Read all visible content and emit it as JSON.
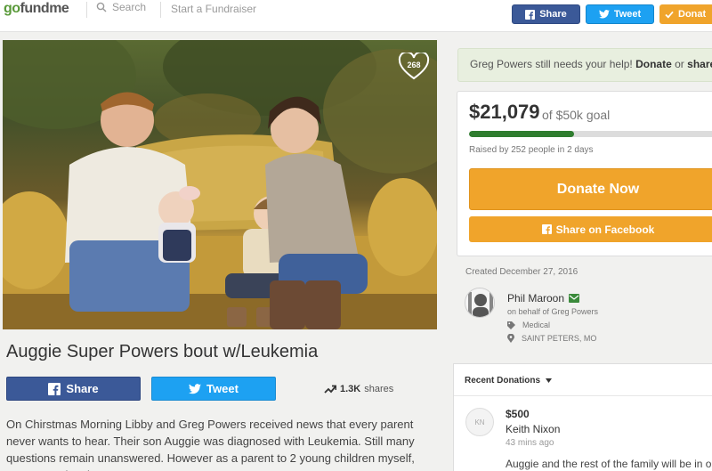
{
  "nav": {
    "logo_go": "go",
    "logo_rest": "fundme",
    "search_label": "Search",
    "start_label": "Start a Fundraiser",
    "share_label": "Share",
    "tweet_label": "Tweet",
    "donate_label": "Donat"
  },
  "hero": {
    "heart_count": "268"
  },
  "campaign": {
    "title": "Auggie Super Powers bout w/Leukemia",
    "share_label": "Share",
    "tweet_label": "Tweet",
    "shares_count": "1.3K",
    "shares_word": "shares",
    "story": "On Chirstmas Morning Libby and Greg Powers received news that every parent never wants to hear. Their son Auggie was diagnosed with Leukemia. Still many questions remain unanswered. However as a parent to 2 young children myself, someone who sits"
  },
  "sidebar": {
    "needs_help_text": "Greg Powers still needs your help!",
    "donate_link": "Donate",
    "or_text": "or",
    "share_link": "share",
    "amount_raised": "$21,079",
    "goal_text": "of $50k goal",
    "progress_fraction": 0.42,
    "raised_by": "Raised by 252 people in 2 days",
    "donate_now_label": "Donate Now",
    "share_fb_label": "Share on Facebook",
    "created": "Created December 27, 2016",
    "organizer_name": "Phil Maroon",
    "on_behalf": "on behalf of Greg Powers",
    "category": "Medical",
    "location": "SAINT PETERS, MO",
    "recent_donations_label": "Recent Donations",
    "donation": {
      "initials": "KN",
      "amount": "$500",
      "name": "Keith Nixon",
      "time": "43 mins ago",
      "message": "Auggie and the rest of the family will be in ou"
    }
  },
  "colors": {
    "facebook": "#3b5998",
    "twitter": "#1da1f2",
    "donate": "#f0a42b",
    "progress": "#2f7d2f"
  }
}
